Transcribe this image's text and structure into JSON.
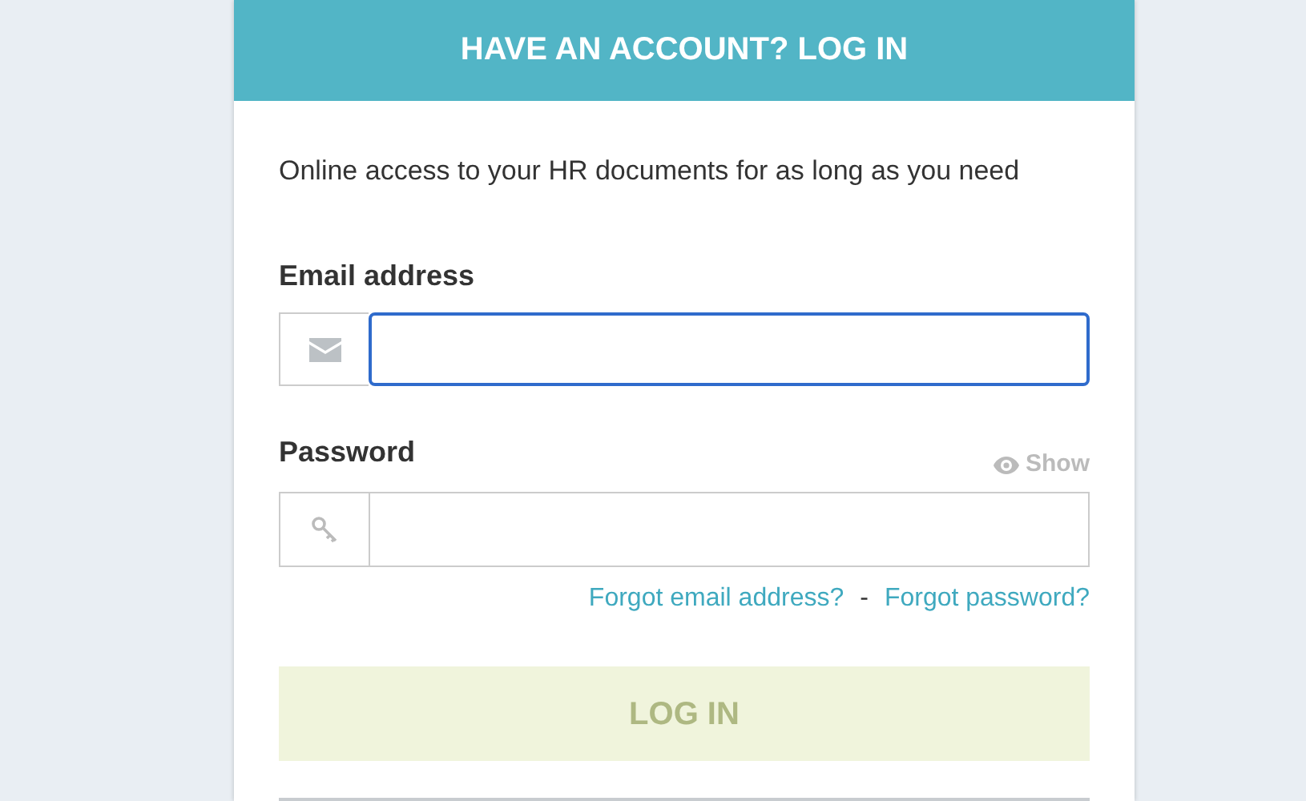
{
  "header": {
    "title": "HAVE AN ACCOUNT? LOG IN"
  },
  "intro": "Online access to your HR documents for as long as you need",
  "email": {
    "label": "Email address",
    "focused": true
  },
  "password": {
    "label": "Password",
    "show_label": "Show",
    "focused": false
  },
  "links": [
    {
      "label": "Forgot email address?"
    },
    {
      "label": "Forgot password?"
    }
  ],
  "separator": "-",
  "login_button": {
    "label": "LOG IN",
    "disabled": true
  }
}
